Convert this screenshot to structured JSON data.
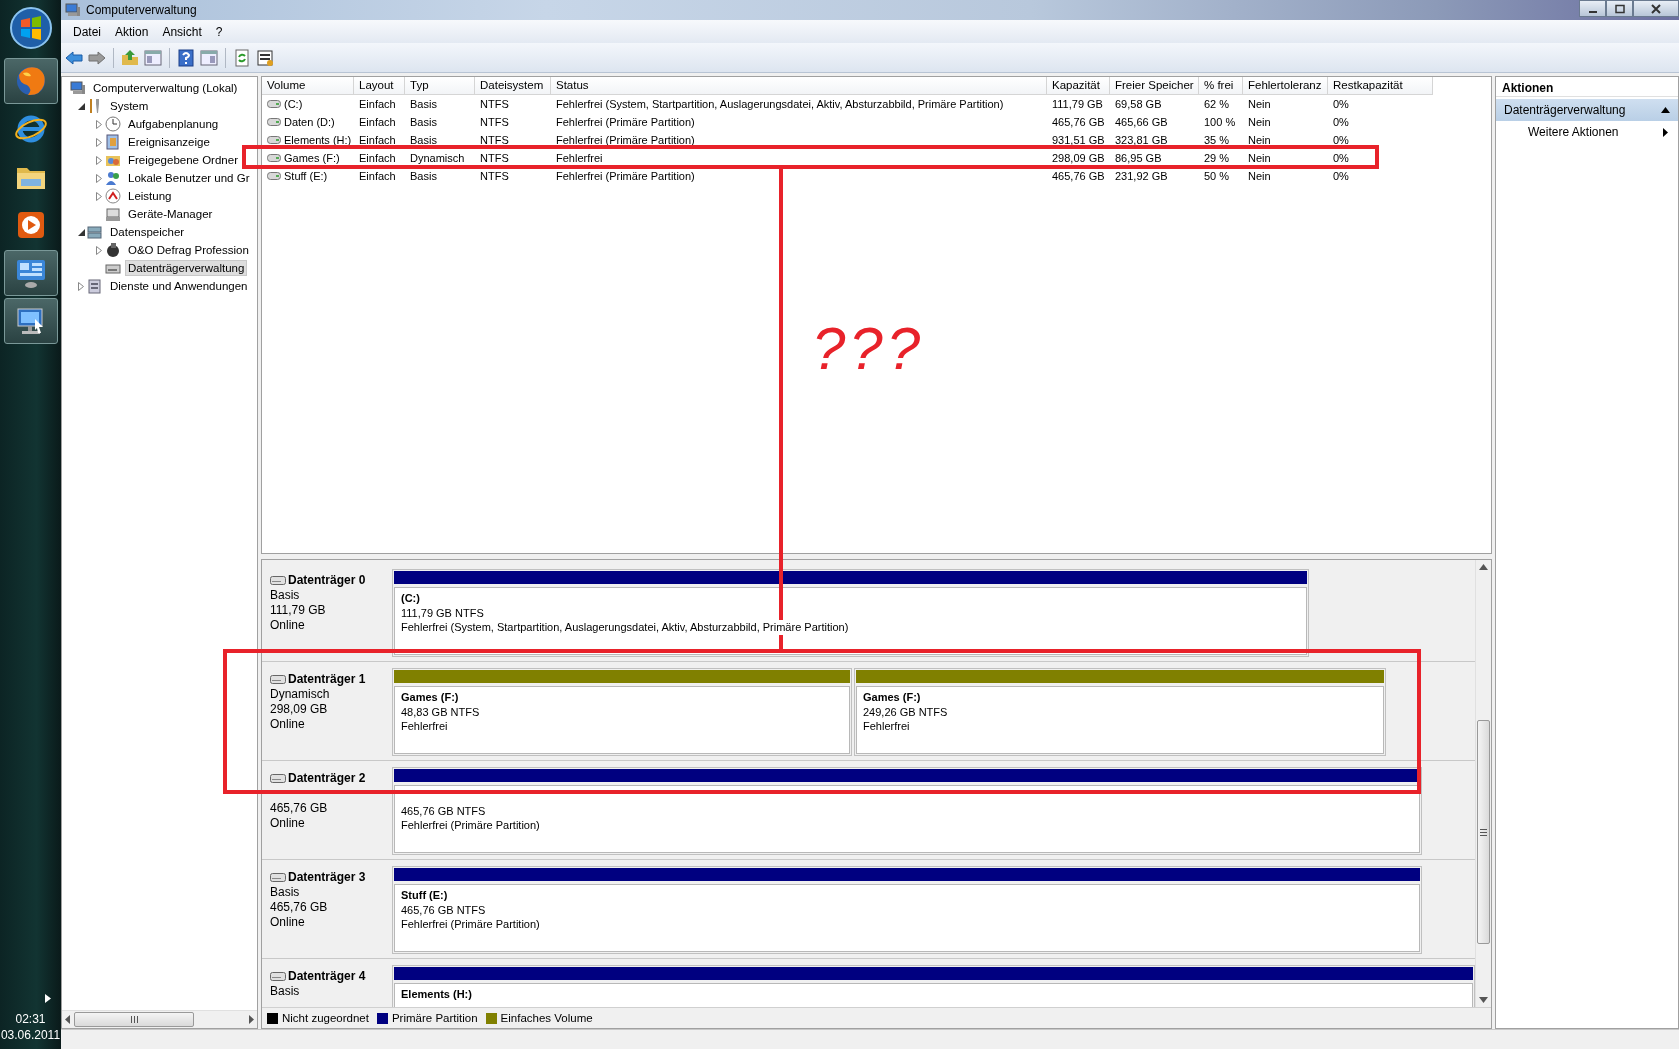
{
  "taskbar": {
    "apps": [
      {
        "running": true
      },
      {
        "running": false
      },
      {
        "running": false
      },
      {
        "running": false
      },
      {
        "running": true
      },
      {
        "running": true
      }
    ],
    "clock": {
      "time": "02:31",
      "date": "03.06.2011"
    }
  },
  "window": {
    "title": "Computerverwaltung"
  },
  "menu": [
    "Datei",
    "Aktion",
    "Ansicht",
    "?"
  ],
  "tree": {
    "items": [
      {
        "label": "Computerverwaltung (Lokal)",
        "selected": false,
        "children": [
          {
            "label": "System",
            "expanded": true,
            "selected": false,
            "children": [
              {
                "label": "Aufgabenplanung",
                "expanded": false,
                "selected": false
              },
              {
                "label": "Ereignisanzeige",
                "expanded": false,
                "selected": false
              },
              {
                "label": "Freigegebene Ordner",
                "expanded": false,
                "selected": false
              },
              {
                "label": "Lokale Benutzer und Gr",
                "expanded": false,
                "selected": false
              },
              {
                "label": "Leistung",
                "expanded": false,
                "selected": false
              },
              {
                "label": "Geräte-Manager",
                "selected": false
              }
            ]
          },
          {
            "label": "Datenspeicher",
            "expanded": true,
            "selected": false,
            "children": [
              {
                "label": "O&O Defrag Profession",
                "expanded": false,
                "selected": false
              },
              {
                "label": "Datenträgerverwaltung",
                "selected": true
              }
            ]
          },
          {
            "label": "Dienste und Anwendungen",
            "expanded": false,
            "selected": false
          }
        ]
      }
    ]
  },
  "volumes": {
    "columns": [
      "Volume",
      "Layout",
      "Typ",
      "Dateisystem",
      "Status",
      "Kapazität",
      "Freier Speicher",
      "% frei",
      "Fehlertoleranz",
      "Restkapazität"
    ],
    "rows": [
      [
        "(C:)",
        "Einfach",
        "Basis",
        "NTFS",
        "Fehlerfrei (System, Startpartition, Auslagerungsdatei, Aktiv, Absturzabbild, Primäre Partition)",
        "111,79 GB",
        "69,58 GB",
        "62 %",
        "Nein",
        "0%"
      ],
      [
        "Daten (D:)",
        "Einfach",
        "Basis",
        "NTFS",
        "Fehlerfrei (Primäre Partition)",
        "465,76 GB",
        "465,66 GB",
        "100 %",
        "Nein",
        "0%"
      ],
      [
        "Elements (H:)",
        "Einfach",
        "Basis",
        "NTFS",
        "Fehlerfrei (Primäre Partition)",
        "931,51 GB",
        "323,81 GB",
        "35 %",
        "Nein",
        "0%"
      ],
      [
        "Games (F:)",
        "Einfach",
        "Dynamisch",
        "NTFS",
        "Fehlerfrei",
        "298,09 GB",
        "86,95 GB",
        "29 %",
        "Nein",
        "0%"
      ],
      [
        "Stuff (E:)",
        "Einfach",
        "Basis",
        "NTFS",
        "Fehlerfrei (Primäre Partition)",
        "465,76 GB",
        "231,92 GB",
        "50 %",
        "Nein",
        "0%"
      ]
    ]
  },
  "disks": [
    {
      "name": "Datenträger 0",
      "type": "Basis",
      "size": "111,79 GB",
      "status": "Online",
      "partitions": [
        {
          "kind": "primary",
          "label": "(C:)",
          "size": "111,79 GB NTFS",
          "status": "Fehlerfrei (System, Startpartition, Auslagerungsdatei, Aktiv, Absturzabbild, Primäre Partition)"
        }
      ]
    },
    {
      "name": "Datenträger 1",
      "type": "Dynamisch",
      "size": "298,09 GB",
      "status": "Online",
      "partitions": [
        {
          "kind": "simple",
          "label": "Games  (F:)",
          "size": "48,83 GB NTFS",
          "status": "Fehlerfrei"
        },
        {
          "kind": "simple",
          "label": "Games  (F:)",
          "size": "249,26 GB NTFS",
          "status": "Fehlerfrei"
        }
      ]
    },
    {
      "name": "Datenträger 2",
      "size": "465,76 GB",
      "status": "Online",
      "partitions": [
        {
          "kind": "primary",
          "size": "465,76 GB NTFS",
          "status": "Fehlerfrei (Primäre Partition)"
        }
      ]
    },
    {
      "name": "Datenträger 3",
      "type": "Basis",
      "size": "465,76 GB",
      "status": "Online",
      "partitions": [
        {
          "kind": "primary",
          "label": "Stuff  (E:)",
          "size": "465,76 GB NTFS",
          "status": "Fehlerfrei (Primäre Partition)"
        }
      ]
    },
    {
      "name": "Datenträger 4",
      "type": "Basis",
      "partitions": [
        {
          "kind": "primary",
          "label": "Elements  (H:)"
        }
      ]
    }
  ],
  "legend": [
    {
      "label": "Nicht zugeordnet",
      "color": "#000000"
    },
    {
      "label": "Primäre Partition",
      "color": "#000080"
    },
    {
      "label": "Einfaches Volume",
      "color": "#808000"
    }
  ],
  "actions": {
    "title": "Aktionen",
    "section": {
      "label": "Datenträgerverwaltung",
      "expanded": true
    },
    "items": [
      "Weitere Aktionen"
    ]
  },
  "annotation": {
    "text": "???"
  }
}
